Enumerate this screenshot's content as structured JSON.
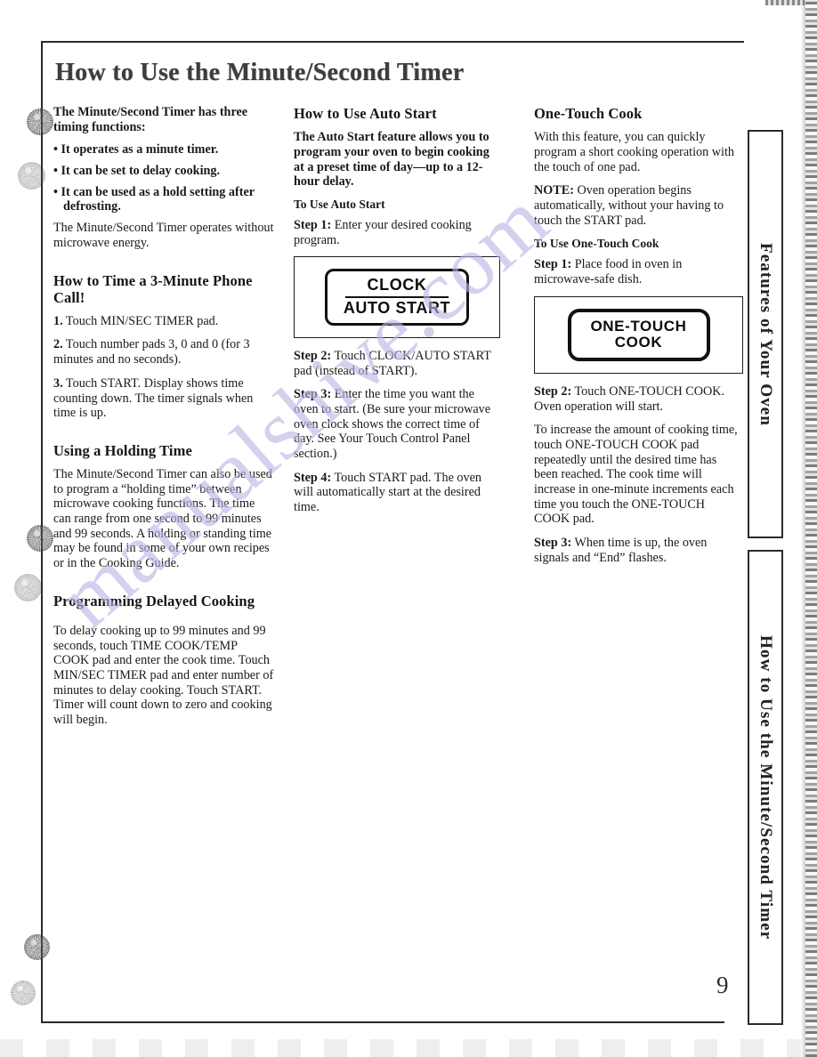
{
  "document": {
    "title": "How to Use the Minute/Second Timer",
    "page_number": "9"
  },
  "watermark": {
    "text": "manualshive.com"
  },
  "side_tabs": [
    {
      "label": "Features of Your Oven"
    },
    {
      "label": "How to Use the Minute/Second Timer"
    }
  ],
  "column_1": {
    "intro": "The Minute/Second Timer has three timing functions:",
    "bullets": [
      "• It operates as a minute timer.",
      "• It can be set to delay cooking.",
      "• It can be used as a hold setting after defrosting."
    ],
    "intro_note": "The Minute/Second Timer operates without microwave energy.",
    "section_phone": {
      "heading": "How to Time a 3-Minute Phone Call!",
      "steps": [
        {
          "lead": "1.",
          "text": " Touch MIN/SEC TIMER pad."
        },
        {
          "lead": "2.",
          "text": " Touch number pads 3, 0 and 0 (for 3 minutes and no seconds)."
        },
        {
          "lead": "3.",
          "text": " Touch START. Display shows time counting down. The timer signals when time is up."
        }
      ]
    },
    "section_holding": {
      "heading": "Using a Holding Time",
      "body": "The Minute/Second Timer can also be used to program a “holding time” between microwave cooking functions. The time can range from one second to 99 minutes and 99 seconds. A holding or standing time may be found in some of your own recipes or in the Cooking Guide."
    },
    "section_delayed": {
      "heading": "Programming Delayed Cooking",
      "body": "To delay cooking up to 99 minutes and 99 seconds, touch TIME COOK/TEMP COOK pad and enter the cook time. Touch MIN/SEC TIMER pad and enter number of minutes to delay cooking. Touch START. Timer will count down to zero and cooking will begin."
    }
  },
  "column_2": {
    "heading": "How to Use Auto Start",
    "intro_bold": "The Auto Start feature allows you to program your oven to begin cooking at a preset time of day—up to a 12-hour delay.",
    "subheading": "To Use Auto Start",
    "step1": {
      "lead": "Step 1:",
      "text": " Enter your desired cooking program."
    },
    "pad": {
      "name": "clock-auto-start-pad",
      "line1": "CLOCK",
      "line2": "AUTO START",
      "has_divider": true
    },
    "step2": {
      "lead": "Step 2:",
      "text": " Touch CLOCK/AUTO START pad (instead of START)."
    },
    "step3": {
      "lead": "Step 3:",
      "text": " Enter the time you want the oven to start. (Be sure your microwave oven clock shows the correct time of day. See Your Touch Control Panel section.)"
    },
    "step4": {
      "lead": "Step 4:",
      "text": " Touch START pad. The oven will automatically start at the desired time."
    }
  },
  "column_3": {
    "heading": "One-Touch Cook",
    "intro": "With this feature, you can quickly program a short cooking operation with the touch of one pad.",
    "note": {
      "lead": "NOTE:",
      "text": " Oven operation begins automatically, without your having to touch the START pad."
    },
    "subheading": "To Use One-Touch Cook",
    "step1": {
      "lead": "Step 1:",
      "text": " Place food in oven in microwave-safe dish."
    },
    "pad": {
      "name": "one-touch-cook-pad",
      "line1": "ONE-TOUCH",
      "line2": "COOK",
      "has_divider": false
    },
    "step2": {
      "lead": "Step 2:",
      "text": " Touch ONE-TOUCH COOK. Oven operation will start."
    },
    "body": "To increase the amount of cooking time, touch ONE-TOUCH COOK pad repeatedly until the desired time has been reached. The cook time will increase in one-minute increments each time you touch the ONE-TOUCH COOK pad.",
    "step3": {
      "lead": "Step 3:",
      "text": " When time is up, the oven signals and “End” flashes."
    }
  },
  "colors": {
    "ink": "#1a1a1a",
    "rule": "#2a2a2a",
    "watermark": "#b9b6e4",
    "paper": "#ffffff"
  }
}
